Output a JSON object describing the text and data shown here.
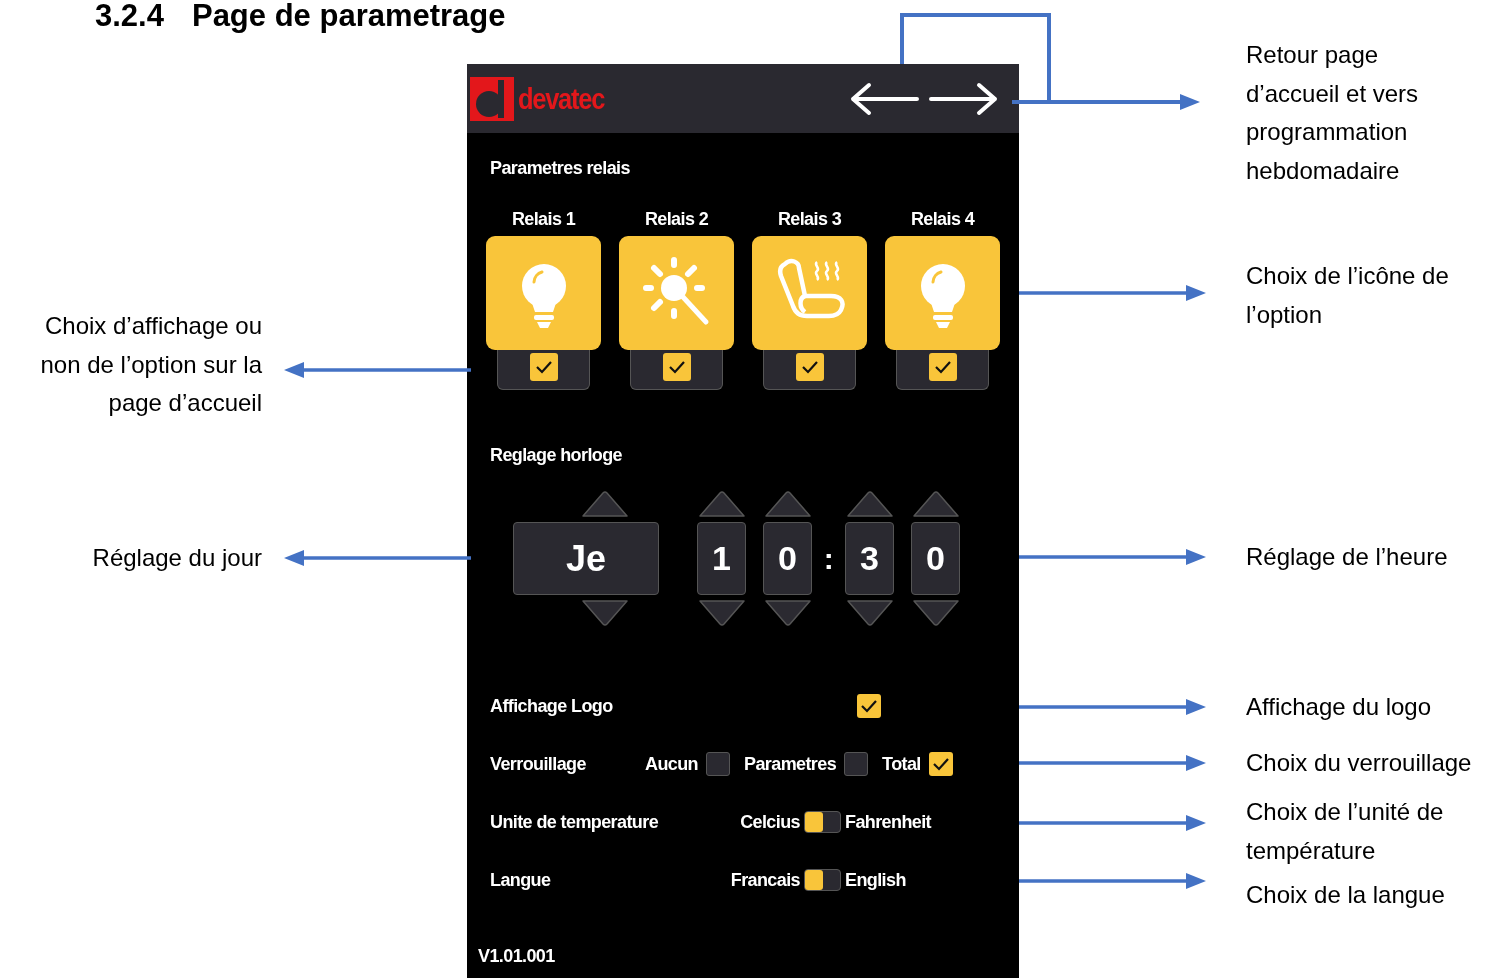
{
  "heading": {
    "number": "3.2.4",
    "title": "Page de parametrage"
  },
  "device": {
    "header": {
      "brand": "devatec"
    },
    "relays_title": "Parametres relais",
    "relays": [
      {
        "label": "Relais 1",
        "kind": "bulb",
        "checked": true
      },
      {
        "label": "Relais 2",
        "kind": "sun",
        "checked": true
      },
      {
        "label": "Relais 3",
        "kind": "seat",
        "checked": true
      },
      {
        "label": "Relais 4",
        "kind": "bulb",
        "checked": true
      }
    ],
    "clock_title": "Reglage horloge",
    "day": "Je",
    "hour_digits": [
      "1",
      "0"
    ],
    "separator": ":",
    "minute_digits": [
      "3",
      "0"
    ],
    "options": [
      {
        "kind": "checkbox",
        "label": "Affichage Logo",
        "checked": true
      },
      {
        "kind": "choices",
        "label": "Verrouillage",
        "choices": [
          {
            "label": "Aucun",
            "selected": false
          },
          {
            "label": "Parametres",
            "selected": false
          },
          {
            "label": "Total",
            "selected": true
          }
        ]
      },
      {
        "kind": "toggle",
        "label": "Unite de temperature",
        "left": "Celcius",
        "right": "Fahrenheit",
        "right_selected": false
      },
      {
        "kind": "toggle",
        "label": "Langue",
        "left": "Francais",
        "right": "English",
        "right_selected": false
      }
    ],
    "version": "V1.01.001"
  },
  "annotations_left": [
    "Choix d’affichage ou non de l’option sur la page d’accueil",
    "Réglage du jour"
  ],
  "annotations_right": [
    "Retour page d’accueil et vers programmation hebdomadaire",
    "Choix de l’icône de l’option",
    "Réglage de l’heure",
    "Affichage du logo",
    "Choix du verrouillage",
    "Choix de l’unité de température",
    "Choix de la langue"
  ]
}
